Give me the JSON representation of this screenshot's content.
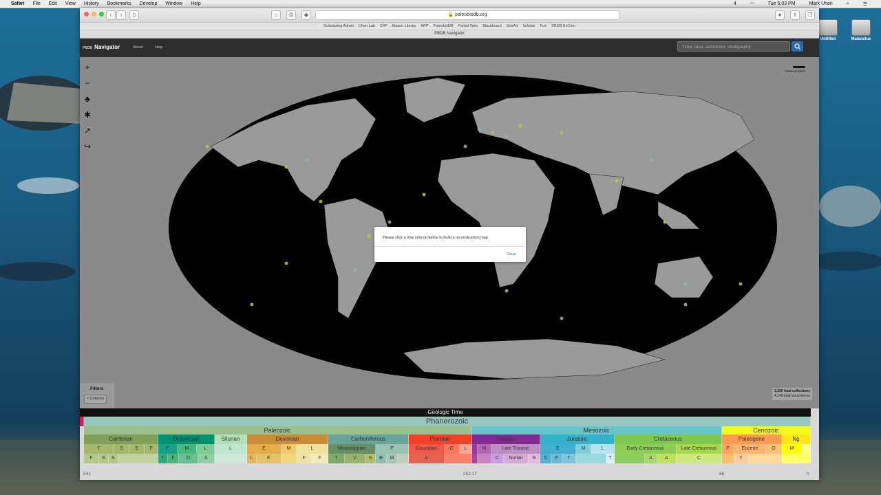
{
  "menubar": {
    "items": [
      "Safari",
      "File",
      "Edit",
      "View",
      "History",
      "Bookmarks",
      "Develop",
      "Window",
      "Help"
    ],
    "battery": "4",
    "clock": "Tue 5:03 PM",
    "user": "Mark Uhen"
  },
  "desktop": {
    "icons": [
      "Untitled",
      "Malacetus"
    ]
  },
  "browser": {
    "url": "paleobiodb.org",
    "bookmarks": [
      "Scheduling Admin",
      "Uhen Lab",
      "C4P",
      "Mason Library",
      "APP",
      "PaleobioDB",
      "Patriot Web",
      "Blackboard",
      "SeoAd",
      "Scholar",
      "Fun",
      "PBDB ExCom"
    ],
    "tab_title": "PBDB Navigator"
  },
  "navbar": {
    "brand_small": "PBDB",
    "brand": "Navigator",
    "links": [
      "About",
      "Help"
    ],
    "search_placeholder": "Time, taxa, authorizer, stratigraphy"
  },
  "map": {
    "legend_label": "Cetacea 100%",
    "collections": "2,320 total collections",
    "occurrences": "4,149 total occurrences"
  },
  "filters": {
    "title": "Filters",
    "chips": [
      "Cetacea"
    ]
  },
  "modal": {
    "message": "Please click a time interval below to build a reconstruction map",
    "close_label": "Close"
  },
  "timescale": {
    "title": "Geologic Time",
    "eon": "Phanerozoic",
    "eras": [
      {
        "label": "Paleozoic",
        "color": "#99c08d"
      },
      {
        "label": "Mesozoic",
        "color": "#67c5ca"
      },
      {
        "label": "Cenozoic",
        "color": "#f2f91d"
      }
    ],
    "periods": [
      "Cambrian",
      "Ordovician",
      "Silurian",
      "Devonian",
      "Carboniferous",
      "Permian",
      "Triassic",
      "Jurassic",
      "Cretaceous",
      "Paleogene",
      "Ng"
    ],
    "subperiods": [
      "Mississippian",
      "P",
      "Cisuralian",
      "G",
      "L",
      "M",
      "Late Triassic",
      "E",
      "M",
      "L",
      "Early Cretaceous",
      "Late Cretaceous",
      "P",
      "Eocene",
      "O",
      "M"
    ],
    "epoch_letters_row1": [
      "T",
      "S",
      "S",
      "F",
      "E",
      "M",
      "L",
      "L",
      "E",
      "M",
      "L",
      "P"
    ],
    "stage_letters_row": [
      "F",
      "S",
      "S",
      "T",
      "F",
      "D",
      "K",
      "L",
      "E",
      "F",
      "F",
      "T",
      "V",
      "S",
      "B",
      "M",
      "A",
      "C",
      "Norian",
      "R",
      "S",
      "P",
      "T",
      "T",
      "A",
      "A",
      "C",
      "Y"
    ],
    "axis": [
      "541",
      "252.17",
      "66",
      "0"
    ]
  }
}
